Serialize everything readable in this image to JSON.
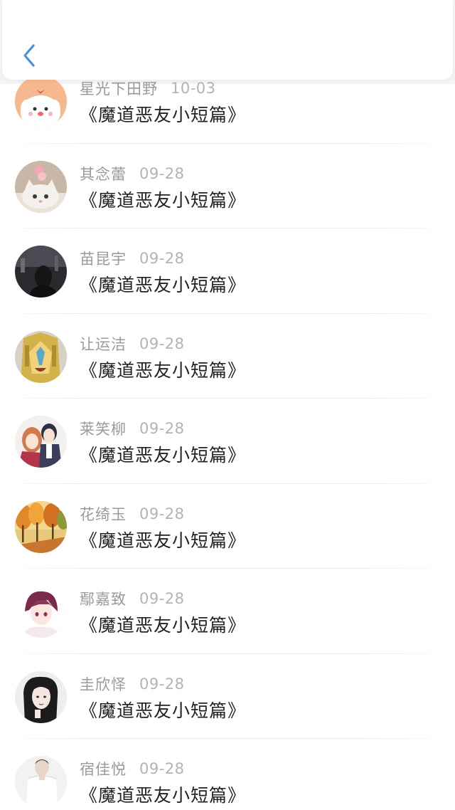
{
  "nav": {
    "back_icon": "chevron-left-icon",
    "accent": "#4a90e2"
  },
  "items": [
    {
      "name": "星光下田野",
      "date": "10-03",
      "title": "《魔道恶友小短篇》"
    },
    {
      "name": "其念蕾",
      "date": "09-28",
      "title": "《魔道恶友小短篇》"
    },
    {
      "name": "苗昆宇",
      "date": "09-28",
      "title": "《魔道恶友小短篇》"
    },
    {
      "name": "让运洁",
      "date": "09-28",
      "title": "《魔道恶友小短篇》"
    },
    {
      "name": "莱笑柳",
      "date": "09-28",
      "title": "《魔道恶友小短篇》"
    },
    {
      "name": "花绮玉",
      "date": "09-28",
      "title": "《魔道恶友小短篇》"
    },
    {
      "name": "鄢嘉致",
      "date": "09-28",
      "title": "《魔道恶友小短篇》"
    },
    {
      "name": "圭欣怿",
      "date": "09-28",
      "title": "《魔道恶友小短篇》"
    },
    {
      "name": "宿佳悦",
      "date": "09-28",
      "title": "《魔道恶友小短篇》"
    }
  ]
}
